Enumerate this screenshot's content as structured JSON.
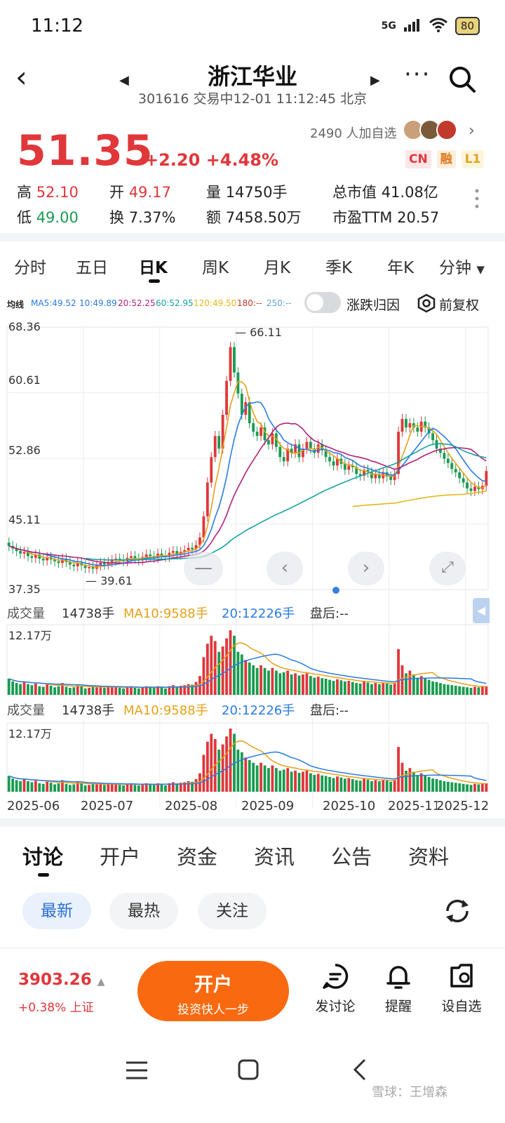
{
  "status": {
    "time": "11:12",
    "network": "5G",
    "battery": "80"
  },
  "header": {
    "title": "浙江华业",
    "subtitle": "301616 交易中12-01 11:12:45 北京"
  },
  "quote": {
    "price": "51.35",
    "change": "+2.20 +4.48%",
    "followers": "2490 人加自选",
    "tags": [
      "CN",
      "融",
      "L1"
    ],
    "high_label": "高",
    "high": "52.10",
    "open_label": "开",
    "open": "49.17",
    "volume_label": "量",
    "volume": "14750手",
    "mktcap_label": "总市值",
    "mktcap": "41.08亿",
    "low_label": "低",
    "low": "49.00",
    "turnover_label": "换",
    "turnover": "7.37%",
    "amount_label": "额",
    "amount": "7458.50万",
    "pe_label": "市盈TTM",
    "pe": "20.57"
  },
  "period_tabs": [
    "分时",
    "五日",
    "日K",
    "周K",
    "月K",
    "季K",
    "年K",
    "分钟"
  ],
  "ma_legend": {
    "label": "均线",
    "items": [
      {
        "text": "MA5:49.52",
        "color": "#2a7be4"
      },
      {
        "text": "10:49.89",
        "color": "#2a7be4"
      },
      {
        "text": "20:52.25",
        "color": "#b0207e"
      },
      {
        "text": "60:52.95",
        "color": "#17a2a2"
      },
      {
        "text": "120:49.50",
        "color": "#e6b818"
      },
      {
        "text": "180:--",
        "color": "#c0392b"
      },
      {
        "text": "250:--",
        "color": "#5da4d9"
      }
    ],
    "toggle_label": "涨跌归因",
    "adjust_label": "前复权"
  },
  "chart_data": {
    "type": "candlestick",
    "y_ticks": [
      "68.36",
      "60.61",
      "52.86",
      "45.11",
      "37.35"
    ],
    "ylim": [
      37.35,
      68.36
    ],
    "max_annotation": "66.11",
    "min_annotation": "39.61",
    "x_ticks": [
      "2025-06",
      "2025-07",
      "2025-08",
      "2025-09",
      "2025-10",
      "2025-11",
      "2025-12"
    ],
    "closes": [
      42.5,
      42.2,
      41.9,
      41.6,
      41.8,
      41.3,
      41.1,
      41.5,
      41.0,
      40.8,
      41.2,
      40.9,
      40.7,
      40.5,
      41.0,
      40.6,
      40.3,
      40.1,
      40.5,
      40.2,
      39.9,
      40.0,
      39.8,
      40.2,
      40.5,
      40.3,
      40.6,
      40.8,
      41.0,
      40.9,
      40.7,
      41.1,
      41.3,
      41.0,
      40.8,
      41.2,
      41.5,
      41.3,
      41.1,
      41.6,
      41.4,
      41.2,
      41.7,
      41.9,
      41.5,
      41.8,
      42.0,
      42.3,
      42.1,
      42.6,
      43.5,
      46.0,
      50.0,
      53.0,
      55.5,
      54.0,
      58.0,
      62.0,
      66.0,
      63.0,
      60.5,
      58.0,
      59.5,
      57.0,
      56.0,
      55.5,
      56.5,
      55.0,
      54.5,
      55.8,
      54.2,
      53.0,
      52.5,
      54.0,
      53.5,
      54.5,
      53.0,
      54.0,
      54.8,
      54.0,
      53.5,
      54.5,
      53.8,
      53.0,
      52.5,
      52.0,
      52.8,
      52.2,
      51.5,
      52.0,
      51.8,
      51.0,
      50.8,
      51.5,
      51.2,
      50.5,
      51.0,
      50.5,
      51.2,
      50.7,
      50.3,
      51.0,
      56.0,
      57.5,
      56.5,
      57.0,
      56.5,
      56.0,
      57.2,
      56.5,
      55.8,
      55.0,
      54.0,
      53.5,
      52.8,
      52.3,
      51.6,
      51.2,
      50.5,
      50.0,
      49.3,
      49.0,
      49.5,
      49.2,
      49.6,
      51.35
    ],
    "moving_averages": [
      {
        "name": "MA5",
        "color": "#2a7be4",
        "value": 49.52
      },
      {
        "name": "MA10",
        "color": "#2a7be4",
        "value": 49.89
      },
      {
        "name": "MA20",
        "color": "#b0207e",
        "value": 52.25
      },
      {
        "name": "MA60",
        "color": "#17a2a2",
        "value": 52.95
      },
      {
        "name": "MA120",
        "color": "#e6b818",
        "value": 49.5
      }
    ]
  },
  "volume_panel": {
    "label": "成交量",
    "vol": "14738手",
    "ma10": "MA10:9588手",
    "ma20": "20:12226手",
    "after": "盘后:--",
    "max": "12.17万"
  },
  "volume_data": [
    3,
    2.5,
    2.2,
    2,
    2.4,
    2,
    1.8,
    2.1,
    1.6,
    1.5,
    1.9,
    1.7,
    1.4,
    1.6,
    2.2,
    1.5,
    1.3,
    1.4,
    1.8,
    1.6,
    1.2,
    1.3,
    1.5,
    1.4,
    1.7,
    1.3,
    1.5,
    1.6,
    1.4,
    1.3,
    1.2,
    1.5,
    1.6,
    1.3,
    1.2,
    1.4,
    1.6,
    1.5,
    1.3,
    1.6,
    1.4,
    1.2,
    1.6,
    1.8,
    1.5,
    1.7,
    1.8,
    2,
    1.9,
    2.4,
    3.5,
    7,
    9.5,
    11,
    10,
    8,
    9,
    10.5,
    12,
    11,
    8,
    7.5,
    6.5,
    6,
    5.5,
    5,
    5.5,
    5,
    4.5,
    5,
    4.5,
    4,
    4.2,
    4.5,
    3.8,
    4,
    3.6,
    3.8,
    4,
    3.5,
    3.2,
    3.4,
    3.1,
    3,
    2.8,
    2.6,
    2.9,
    2.7,
    2.5,
    2.6,
    2.4,
    2.2,
    2.1,
    2.5,
    2.3,
    2,
    2.2,
    2,
    2.3,
    2.1,
    1.9,
    2.2,
    8.5,
    5.5,
    4,
    4.5,
    3.8,
    3.2,
    3.5,
    3,
    2.8,
    2.5,
    2.4,
    2.2,
    2,
    1.9,
    1.8,
    1.7,
    1.6,
    1.5,
    1.4,
    1.3,
    1.5,
    1.4,
    1.5,
    1.6
  ],
  "content_tabs": [
    "讨论",
    "开户",
    "资金",
    "资讯",
    "公告",
    "资料"
  ],
  "filters": [
    "最新",
    "最热",
    "关注"
  ],
  "bottom": {
    "index_price": "3903.26",
    "index_change": "+0.38% 上证",
    "open_title": "开户",
    "open_sub": "投资快人一步",
    "items": [
      "发讨论",
      "提醒",
      "设自选"
    ]
  },
  "watermark": "雪球：王增森",
  "colors": {
    "up": "#e0373b",
    "down": "#1a9b50",
    "accent": "#f96a10"
  }
}
